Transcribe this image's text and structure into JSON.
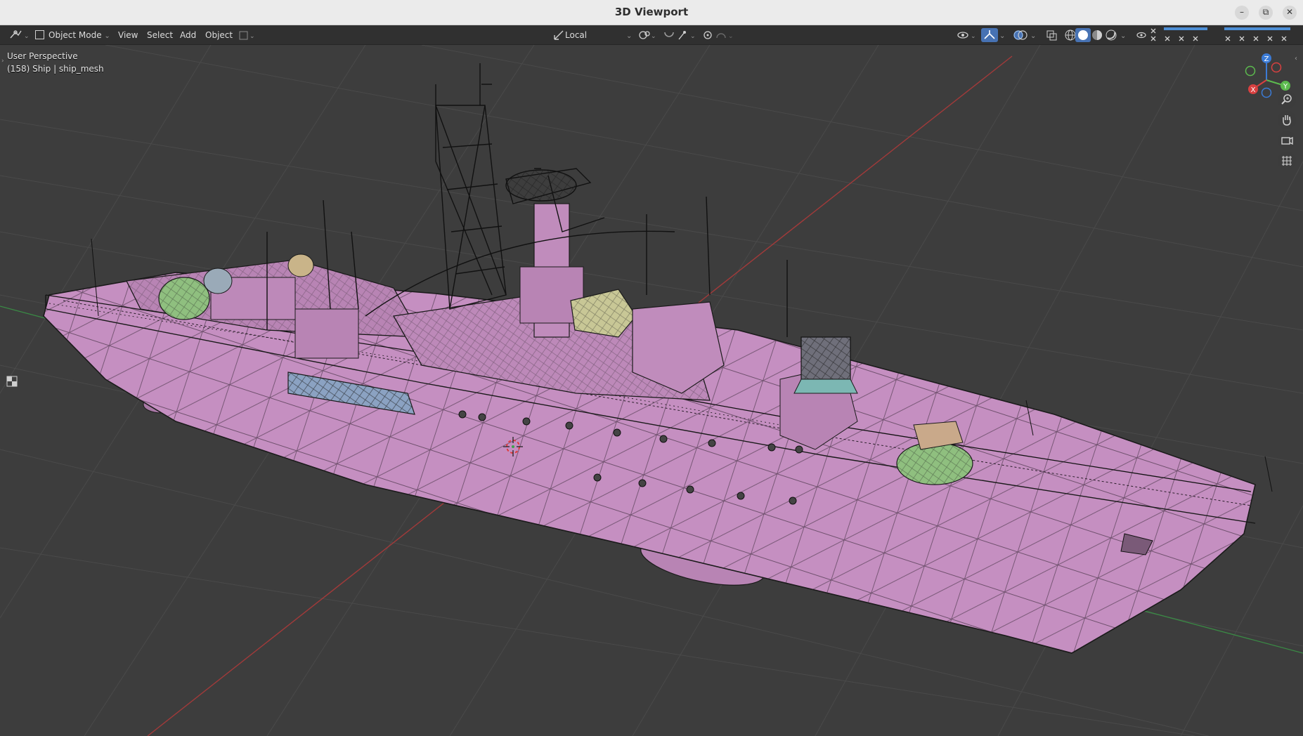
{
  "window": {
    "title": "3D Viewport",
    "controls": {
      "minimize": "–",
      "restore": "⧉",
      "close": "✕"
    }
  },
  "header": {
    "editor_type_icon": "camera-view-icon",
    "mode": "Object Mode",
    "menus": [
      "View",
      "Select",
      "Add",
      "Object"
    ],
    "transform_orientation": "Local",
    "overlay_toggles": [
      "eye-icon",
      "gizmo-icon",
      "overlay-icon",
      "xray-icon"
    ],
    "shading_modes": [
      "wireframe",
      "solid",
      "material",
      "rendered"
    ],
    "active_shading": "solid"
  },
  "viewport": {
    "perspective_label": "User Perspective",
    "object_info": "(158) Ship | ship_mesh",
    "gizmo_axes": {
      "x": "X",
      "y": "Y",
      "z": "Z"
    },
    "nav_buttons": [
      "zoom-icon",
      "hand-pan-icon",
      "camera-icon",
      "grid-ortho-icon"
    ],
    "colors": {
      "background": "#3d3d3d",
      "hull": "#c58fc1",
      "wire": "#1a1a1a",
      "axis_x": "#c0392b",
      "axis_y": "#3fa34d",
      "accent": "#4772b3"
    }
  }
}
